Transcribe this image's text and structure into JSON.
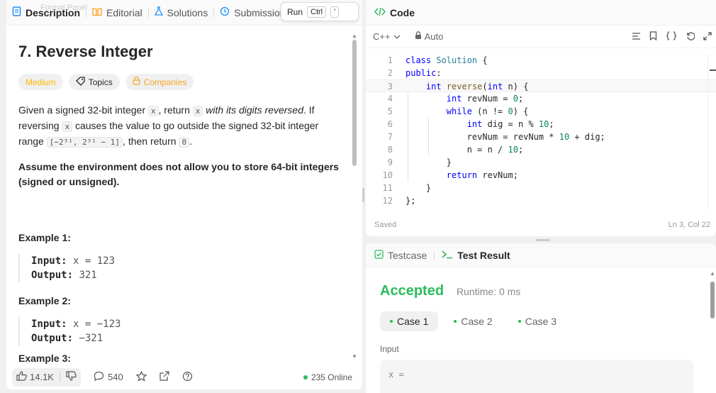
{
  "left_tabs": {
    "description": "Description",
    "editorial": "Editorial",
    "solutions": "Solutions",
    "submissions": "Submission",
    "ghost_text": "Format Panel"
  },
  "run_hint": {
    "run": "Run",
    "ctrl": "Ctrl",
    "key": "'"
  },
  "problem": {
    "title": "7. Reverse Integer",
    "tags": {
      "difficulty": "Medium",
      "topics": "Topics",
      "companies": "Companies"
    },
    "statement_1": "Given a signed 32-bit integer ",
    "code_x": "x",
    "statement_2": ", return ",
    "statement_3_em": " with its digits reversed",
    "statement_4": ". If reversing ",
    "statement_5": " causes the value to go outside the signed 32-bit integer range ",
    "range_code": "[−2³¹, 2³¹ − 1]",
    "statement_6": ", then return ",
    "zero_code": "0",
    "statement_7": ".",
    "note": "Assume the environment does not allow you to store 64-bit integers (signed or unsigned).",
    "examples": [
      {
        "heading": "Example 1:",
        "input_label": "Input:",
        "input": "x = 123",
        "output_label": "Output:",
        "output": "321"
      },
      {
        "heading": "Example 2:",
        "input_label": "Input:",
        "input": "x = −123",
        "output_label": "Output:",
        "output": "−321"
      }
    ],
    "example3_partial": "Example 3:"
  },
  "footer": {
    "likes": "14.1K",
    "comments": "540",
    "online": "235 Online"
  },
  "code": {
    "header": "Code",
    "language": "C++",
    "auto": "Auto",
    "status_saved": "Saved",
    "cursor_pos": "Ln 3, Col 22",
    "lines": [
      "1",
      "2",
      "3",
      "4",
      "5",
      "6",
      "7",
      "8",
      "9",
      "10",
      "11",
      "12"
    ]
  },
  "result": {
    "testcase_tab": "Testcase",
    "result_tab": "Test Result",
    "verdict": "Accepted",
    "runtime": "Runtime: 0 ms",
    "cases": [
      "Case 1",
      "Case 2",
      "Case 3"
    ],
    "input_label": "Input",
    "input_value": "x ="
  },
  "colors": {
    "accent_green": "#2cbb5d",
    "medium_yellow": "#ffb800",
    "keyword_blue": "#0000ff"
  },
  "icons": [
    "description-icon",
    "editorial-icon",
    "solutions-icon",
    "submissions-icon",
    "code-icon",
    "lock-icon",
    "format-icon",
    "bookmark-icon",
    "braces-icon",
    "undo-icon",
    "expand-icon",
    "testcase-icon",
    "terminal-icon",
    "thumbs-up-icon",
    "thumbs-down-icon",
    "comment-icon",
    "star-icon",
    "share-icon",
    "help-icon"
  ]
}
